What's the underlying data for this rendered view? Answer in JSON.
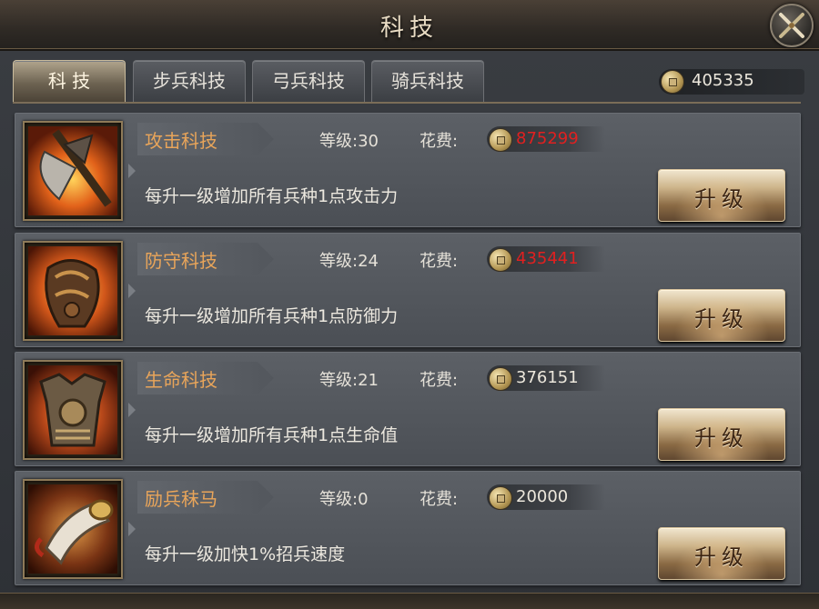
{
  "window": {
    "title": "科技"
  },
  "tabs": [
    {
      "label": "科 技",
      "active": true
    },
    {
      "label": "步兵科技",
      "active": false
    },
    {
      "label": "弓兵科技",
      "active": false
    },
    {
      "label": "骑兵科技",
      "active": false
    }
  ],
  "currency": {
    "icon": "coin-icon",
    "value": "405335"
  },
  "techs": [
    {
      "name": "攻击科技",
      "level": "等级:30",
      "cost_label": "花费:",
      "cost": "875299",
      "affordable": false,
      "desc": "每升一级增加所有兵种1点攻击力",
      "button": "升级",
      "icon": "axe-icon"
    },
    {
      "name": "防守科技",
      "level": "等级:24",
      "cost_label": "花费:",
      "cost": "435441",
      "affordable": false,
      "desc": "每升一级增加所有兵种1点防御力",
      "button": "升级",
      "icon": "shoulder-armor-icon"
    },
    {
      "name": "生命科技",
      "level": "等级:21",
      "cost_label": "花费:",
      "cost": "376151",
      "affordable": true,
      "desc": "每升一级增加所有兵种1点生命值",
      "button": "升级",
      "icon": "chest-armor-icon"
    },
    {
      "name": "励兵秣马",
      "level": "等级:0",
      "cost_label": "花费:",
      "cost": "20000",
      "affordable": true,
      "desc": "每升一级加快1%招兵速度",
      "button": "升级",
      "icon": "war-horn-icon"
    }
  ],
  "colors": {
    "name": "#e9a55a",
    "cost_unaffordable": "#e02020",
    "cost_affordable": "#ece7dc"
  }
}
